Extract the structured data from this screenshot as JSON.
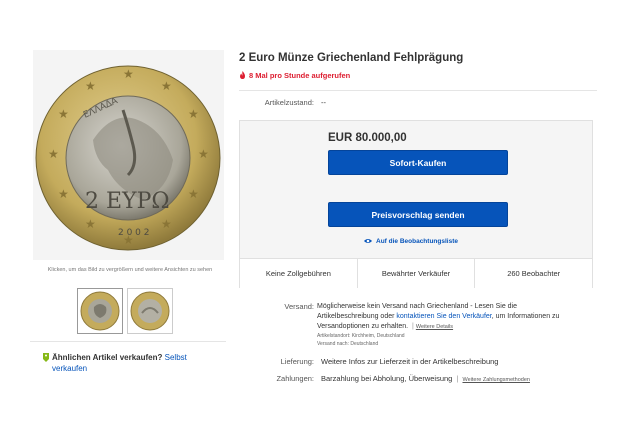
{
  "left": {
    "click_hint": "Klicken, um das Bild zu vergrößern und weitere Ansichten zu sehen",
    "coin_text": {
      "country": "ΕΛΛΑΔΑ",
      "denomination": "2 ΕΥΡΩ",
      "year": "2 0 0 2"
    },
    "similar": {
      "bold": "Ähnlichen Artikel verkaufen?",
      "link": "Selbst verkaufen"
    }
  },
  "item": {
    "title": "2 Euro Münze Griechenland Fehlprägung",
    "hot": "8 Mal pro Stunde aufgerufen",
    "condition_label": "Artikelzustand:",
    "condition_value": "--"
  },
  "buybox": {
    "price": "EUR 80.000,00",
    "buy_now": "Sofort-Kaufen",
    "make_offer": "Preisvorschlag senden",
    "watchlist": "Auf die Beobachtungsliste",
    "stats": [
      "Keine Zollgebühren",
      "Bewährter Verkäufer",
      "260 Beobachter"
    ]
  },
  "shipping": {
    "label": "Versand:",
    "text1": "Möglicherweise kein Versand nach Griechenland - Lesen Sie die Artikelbeschreibung oder",
    "contact_link": "kontaktieren Sie den Verkäufer",
    "text2": ", um Informationen zu Versandoptionen zu erhalten.",
    "details_link": "Weitere Details",
    "location": "Artikelstandort:  Kirchheim, Deutschland",
    "ships_to": "Versand nach:  Deutschland"
  },
  "delivery": {
    "label": "Lieferung:",
    "value": "Weitere Infos zur Lieferzeit in der Artikelbeschreibung"
  },
  "payment": {
    "label": "Zahlungen:",
    "value": "Barzahlung bei Abholung,  Überweisung",
    "more_link": "Weitere Zahlungsmethoden"
  },
  "colors": {
    "accent": "#0654ba",
    "hot": "#dd1e31",
    "box": "#f5f5f5"
  }
}
